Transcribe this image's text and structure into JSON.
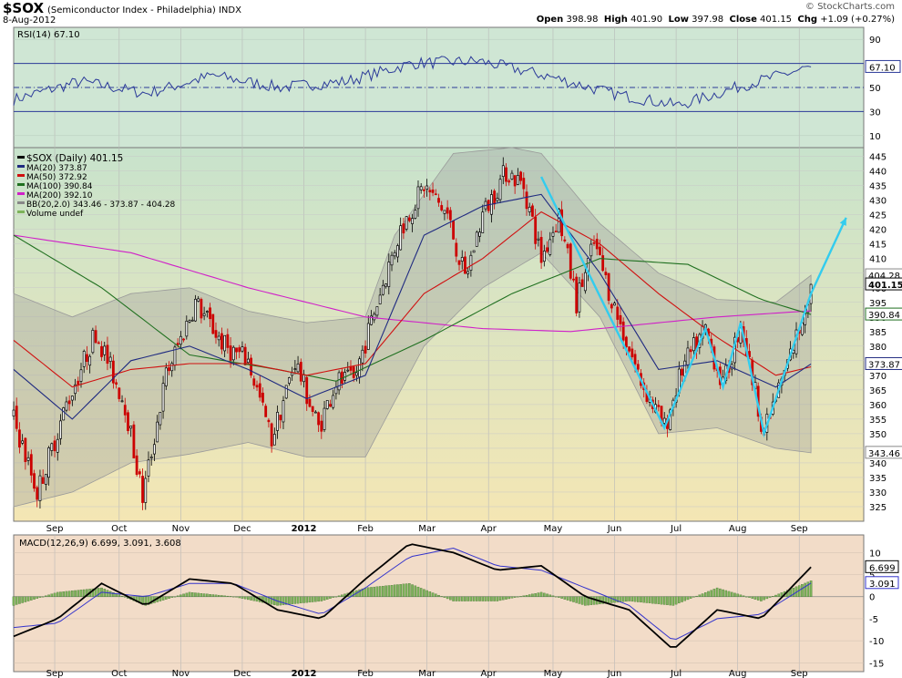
{
  "header": {
    "symbol": "$SOX",
    "description": "(Semiconductor Index - Philadelphia)",
    "exchange": "INDX",
    "date": "8-Aug-2012",
    "watermark": "© StockCharts.com",
    "open_label": "Open",
    "open": "398.98",
    "high_label": "High",
    "high": "401.90",
    "low_label": "Low",
    "low": "397.98",
    "close_label": "Close",
    "close": "401.15",
    "chg_label": "Chg",
    "chg": "+1.09 (+0.27%)"
  },
  "colors": {
    "rsi_bg": "#cfe6d4",
    "price_bg_top": "#c8e3cc",
    "price_bg_bottom": "#f4e6b4",
    "macd_bg": "#f2dcc8",
    "candle_up": "#000000",
    "candle_down": "#cc0000",
    "ma20": "#1f2a80",
    "ma50": "#d01010",
    "ma100": "#207020",
    "ma200": "#d020c8",
    "bb": "#9a9a9a",
    "annotation": "#33ccee",
    "macd_line": "#000000",
    "signal_line": "#3333cc",
    "hist": "#7db35a"
  },
  "chart_data": [
    {
      "type": "line",
      "panel": "rsi",
      "legend": "RSI(14) 67.10",
      "current_value": "67.10",
      "y_ticks": [
        "90",
        "70",
        "50",
        "30",
        "10"
      ],
      "ylim": [
        0,
        100
      ],
      "reference_lines": [
        70,
        50,
        30
      ],
      "x": [
        "Aug",
        "Sep",
        "Oct",
        "Nov",
        "Dec",
        "2012",
        "Feb",
        "Mar",
        "Apr",
        "May",
        "Jun",
        "Jul",
        "Aug"
      ],
      "values": [
        40,
        55,
        45,
        60,
        50,
        55,
        70,
        72,
        60,
        45,
        35,
        52,
        67.1
      ]
    },
    {
      "type": "candlestick",
      "panel": "price",
      "legend": [
        "$SOX (Daily) 401.15",
        "MA(20) 373.87",
        "MA(50) 372.92",
        "MA(100) 390.84",
        "MA(200) 392.10",
        "BB(20,2.0) 343.46 - 373.87 - 404.28",
        "Volume undef"
      ],
      "y_ticks": [
        "445",
        "440",
        "435",
        "430",
        "425",
        "420",
        "415",
        "410",
        "405",
        "400",
        "395",
        "390",
        "385",
        "380",
        "375",
        "370",
        "365",
        "360",
        "355",
        "350",
        "345",
        "340",
        "335",
        "330",
        "325"
      ],
      "ylim": [
        320,
        448
      ],
      "x_ticks": [
        "Sep",
        "Oct",
        "Nov",
        "Dec",
        "2012",
        "Feb",
        "Mar",
        "Apr",
        "May",
        "Jun",
        "Jul",
        "Aug",
        "Sep"
      ],
      "price_tags": [
        "404.28",
        "401.15",
        "390.84",
        "373.87",
        "343.46"
      ],
      "anchors": [
        {
          "d": 0,
          "c": 355
        },
        {
          "d": 8,
          "c": 330
        },
        {
          "d": 18,
          "c": 360
        },
        {
          "d": 28,
          "c": 385
        },
        {
          "d": 38,
          "c": 360
        },
        {
          "d": 44,
          "c": 328
        },
        {
          "d": 52,
          "c": 370
        },
        {
          "d": 62,
          "c": 395
        },
        {
          "d": 72,
          "c": 380
        },
        {
          "d": 80,
          "c": 375
        },
        {
          "d": 88,
          "c": 348
        },
        {
          "d": 96,
          "c": 375
        },
        {
          "d": 104,
          "c": 352
        },
        {
          "d": 110,
          "c": 368
        },
        {
          "d": 116,
          "c": 368
        },
        {
          "d": 124,
          "c": 395
        },
        {
          "d": 132,
          "c": 420
        },
        {
          "d": 140,
          "c": 435
        },
        {
          "d": 148,
          "c": 425
        },
        {
          "d": 154,
          "c": 403
        },
        {
          "d": 160,
          "c": 425
        },
        {
          "d": 168,
          "c": 440
        },
        {
          "d": 174,
          "c": 435
        },
        {
          "d": 180,
          "c": 410
        },
        {
          "d": 186,
          "c": 425
        },
        {
          "d": 192,
          "c": 395
        },
        {
          "d": 198,
          "c": 415
        },
        {
          "d": 206,
          "c": 390
        },
        {
          "d": 214,
          "c": 368
        },
        {
          "d": 222,
          "c": 352
        },
        {
          "d": 228,
          "c": 372
        },
        {
          "d": 236,
          "c": 386
        },
        {
          "d": 242,
          "c": 366
        },
        {
          "d": 248,
          "c": 388
        },
        {
          "d": 256,
          "c": 350
        },
        {
          "d": 262,
          "c": 368
        },
        {
          "d": 268,
          "c": 386
        },
        {
          "d": 272,
          "c": 401.15
        }
      ],
      "moving_averages": {
        "ma20": [
          [
            0,
            372
          ],
          [
            20,
            355
          ],
          [
            40,
            375
          ],
          [
            60,
            380
          ],
          [
            80,
            372
          ],
          [
            100,
            362
          ],
          [
            120,
            370
          ],
          [
            140,
            418
          ],
          [
            160,
            428
          ],
          [
            180,
            432
          ],
          [
            200,
            405
          ],
          [
            220,
            372
          ],
          [
            240,
            375
          ],
          [
            260,
            366
          ],
          [
            272,
            373.87
          ]
        ],
        "ma50": [
          [
            0,
            382
          ],
          [
            20,
            366
          ],
          [
            40,
            372
          ],
          [
            60,
            374
          ],
          [
            80,
            374
          ],
          [
            100,
            370
          ],
          [
            120,
            374
          ],
          [
            140,
            398
          ],
          [
            160,
            410
          ],
          [
            180,
            426
          ],
          [
            200,
            415
          ],
          [
            220,
            398
          ],
          [
            240,
            383
          ],
          [
            260,
            370
          ],
          [
            272,
            372.92
          ]
        ],
        "ma100": [
          [
            0,
            418
          ],
          [
            30,
            400
          ],
          [
            60,
            377
          ],
          [
            90,
            372
          ],
          [
            110,
            368
          ],
          [
            140,
            382
          ],
          [
            170,
            398
          ],
          [
            200,
            410
          ],
          [
            230,
            408
          ],
          [
            255,
            396
          ],
          [
            272,
            390.84
          ]
        ],
        "ma200": [
          [
            0,
            418
          ],
          [
            40,
            412
          ],
          [
            80,
            400
          ],
          [
            120,
            390
          ],
          [
            160,
            386
          ],
          [
            190,
            385
          ],
          [
            210,
            387
          ],
          [
            240,
            390
          ],
          [
            272,
            392.1
          ]
        ],
        "bb_upper": [
          [
            0,
            398
          ],
          [
            20,
            390
          ],
          [
            40,
            398
          ],
          [
            60,
            400
          ],
          [
            80,
            392
          ],
          [
            100,
            388
          ],
          [
            120,
            390
          ],
          [
            130,
            418
          ],
          [
            150,
            446
          ],
          [
            170,
            448
          ],
          [
            180,
            446
          ],
          [
            200,
            422
          ],
          [
            220,
            405
          ],
          [
            240,
            396
          ],
          [
            260,
            395
          ],
          [
            272,
            404.28
          ]
        ],
        "bb_lower": [
          [
            0,
            325
          ],
          [
            20,
            330
          ],
          [
            40,
            340
          ],
          [
            60,
            343
          ],
          [
            80,
            347
          ],
          [
            100,
            342
          ],
          [
            120,
            342
          ],
          [
            140,
            380
          ],
          [
            160,
            400
          ],
          [
            180,
            412
          ],
          [
            200,
            390
          ],
          [
            220,
            350
          ],
          [
            240,
            352
          ],
          [
            260,
            345
          ],
          [
            272,
            343.46
          ]
        ]
      },
      "annotations": [
        [
          [
            180,
            438
          ],
          [
            222,
            352
          ],
          [
            236,
            386
          ],
          [
            242,
            366
          ],
          [
            248,
            388
          ],
          [
            256,
            350
          ],
          [
            272,
            398
          ],
          [
            284,
            424
          ]
        ]
      ]
    },
    {
      "type": "line",
      "panel": "macd",
      "legend": "MACD(12,26,9) 6.699, 3.091, 3.608",
      "macd_value": "6.699",
      "signal_value": "3.091",
      "hist_value": "3.608",
      "y_ticks": [
        "10",
        "5",
        "0",
        "-5",
        "-10",
        "-15"
      ],
      "ylim": [
        -17,
        14
      ],
      "x_ticks": [
        "Sep",
        "Oct",
        "Nov",
        "Dec",
        "2012",
        "Feb",
        "Mar",
        "Apr",
        "May",
        "Jun",
        "Jul",
        "Aug",
        "Sep"
      ],
      "series": [
        {
          "name": "MACD",
          "points": [
            [
              0,
              -9
            ],
            [
              15,
              -5
            ],
            [
              30,
              3
            ],
            [
              45,
              -2
            ],
            [
              60,
              4
            ],
            [
              75,
              3
            ],
            [
              90,
              -3
            ],
            [
              105,
              -5
            ],
            [
              120,
              4
            ],
            [
              135,
              12
            ],
            [
              150,
              10
            ],
            [
              165,
              6
            ],
            [
              180,
              7
            ],
            [
              195,
              0
            ],
            [
              210,
              -3
            ],
            [
              225,
              -12
            ],
            [
              240,
              -3
            ],
            [
              255,
              -5
            ],
            [
              272,
              6.7
            ]
          ]
        },
        {
          "name": "Signal",
          "points": [
            [
              0,
              -7
            ],
            [
              15,
              -6
            ],
            [
              30,
              1
            ],
            [
              45,
              0
            ],
            [
              60,
              3
            ],
            [
              75,
              3
            ],
            [
              90,
              -1
            ],
            [
              105,
              -4
            ],
            [
              120,
              2
            ],
            [
              135,
              9
            ],
            [
              150,
              11
            ],
            [
              165,
              7
            ],
            [
              180,
              6
            ],
            [
              195,
              2
            ],
            [
              210,
              -2
            ],
            [
              225,
              -10
            ],
            [
              240,
              -5
            ],
            [
              255,
              -4
            ],
            [
              272,
              3.09
            ]
          ]
        }
      ]
    }
  ]
}
